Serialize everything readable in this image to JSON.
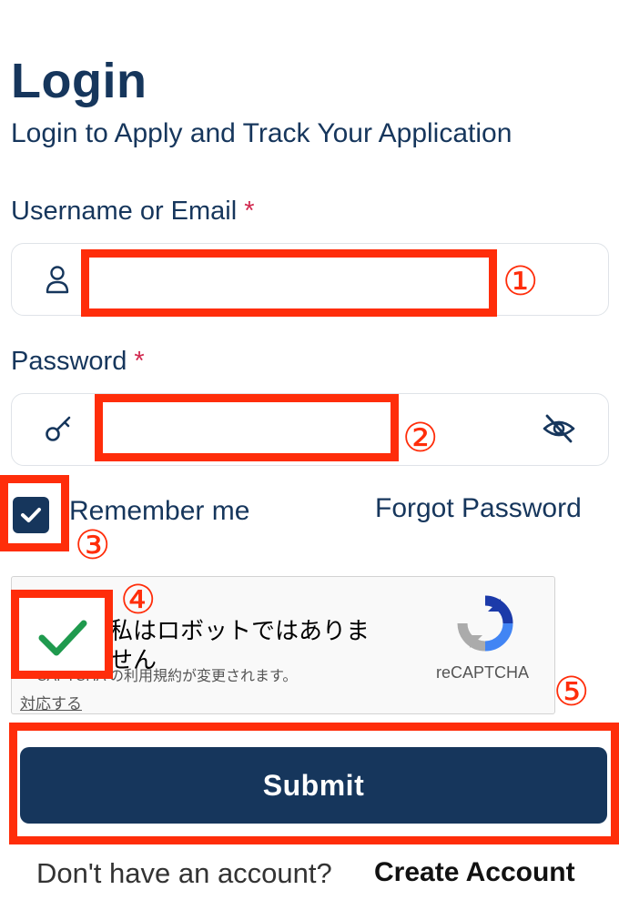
{
  "header": {
    "title": "Login",
    "subtitle": "Login to Apply and Track Your Application"
  },
  "form": {
    "username_label": "Username or Email",
    "username_required": "*",
    "username_value": "",
    "password_label": "Password",
    "password_required": "*",
    "password_value": "",
    "remember_label": "Remember me",
    "remember_checked": true,
    "forgot_link": "Forgot Password",
    "submit_label": "Submit"
  },
  "captcha": {
    "text": "私はロボットではありません",
    "checked": true,
    "notice": "CAPTCHA の利用規約が変更されます。",
    "action_link": "対応する",
    "brand": "reCAPTCHA"
  },
  "footer": {
    "prompt": "Don't have an account?",
    "create_link": "Create Account"
  },
  "annotations": {
    "n1": "①",
    "n2": "②",
    "n3": "③",
    "n4": "④",
    "n5": "⑤",
    "color": "#ff2d0a"
  },
  "theme": {
    "primary": "#16365c",
    "required": "#d1294f",
    "check_green": "#1f9a4e"
  },
  "icons": {
    "username": "user-icon",
    "password": "key-icon",
    "visibility": "eye-off-icon",
    "captcha_logo": "recaptcha-logo-icon"
  }
}
